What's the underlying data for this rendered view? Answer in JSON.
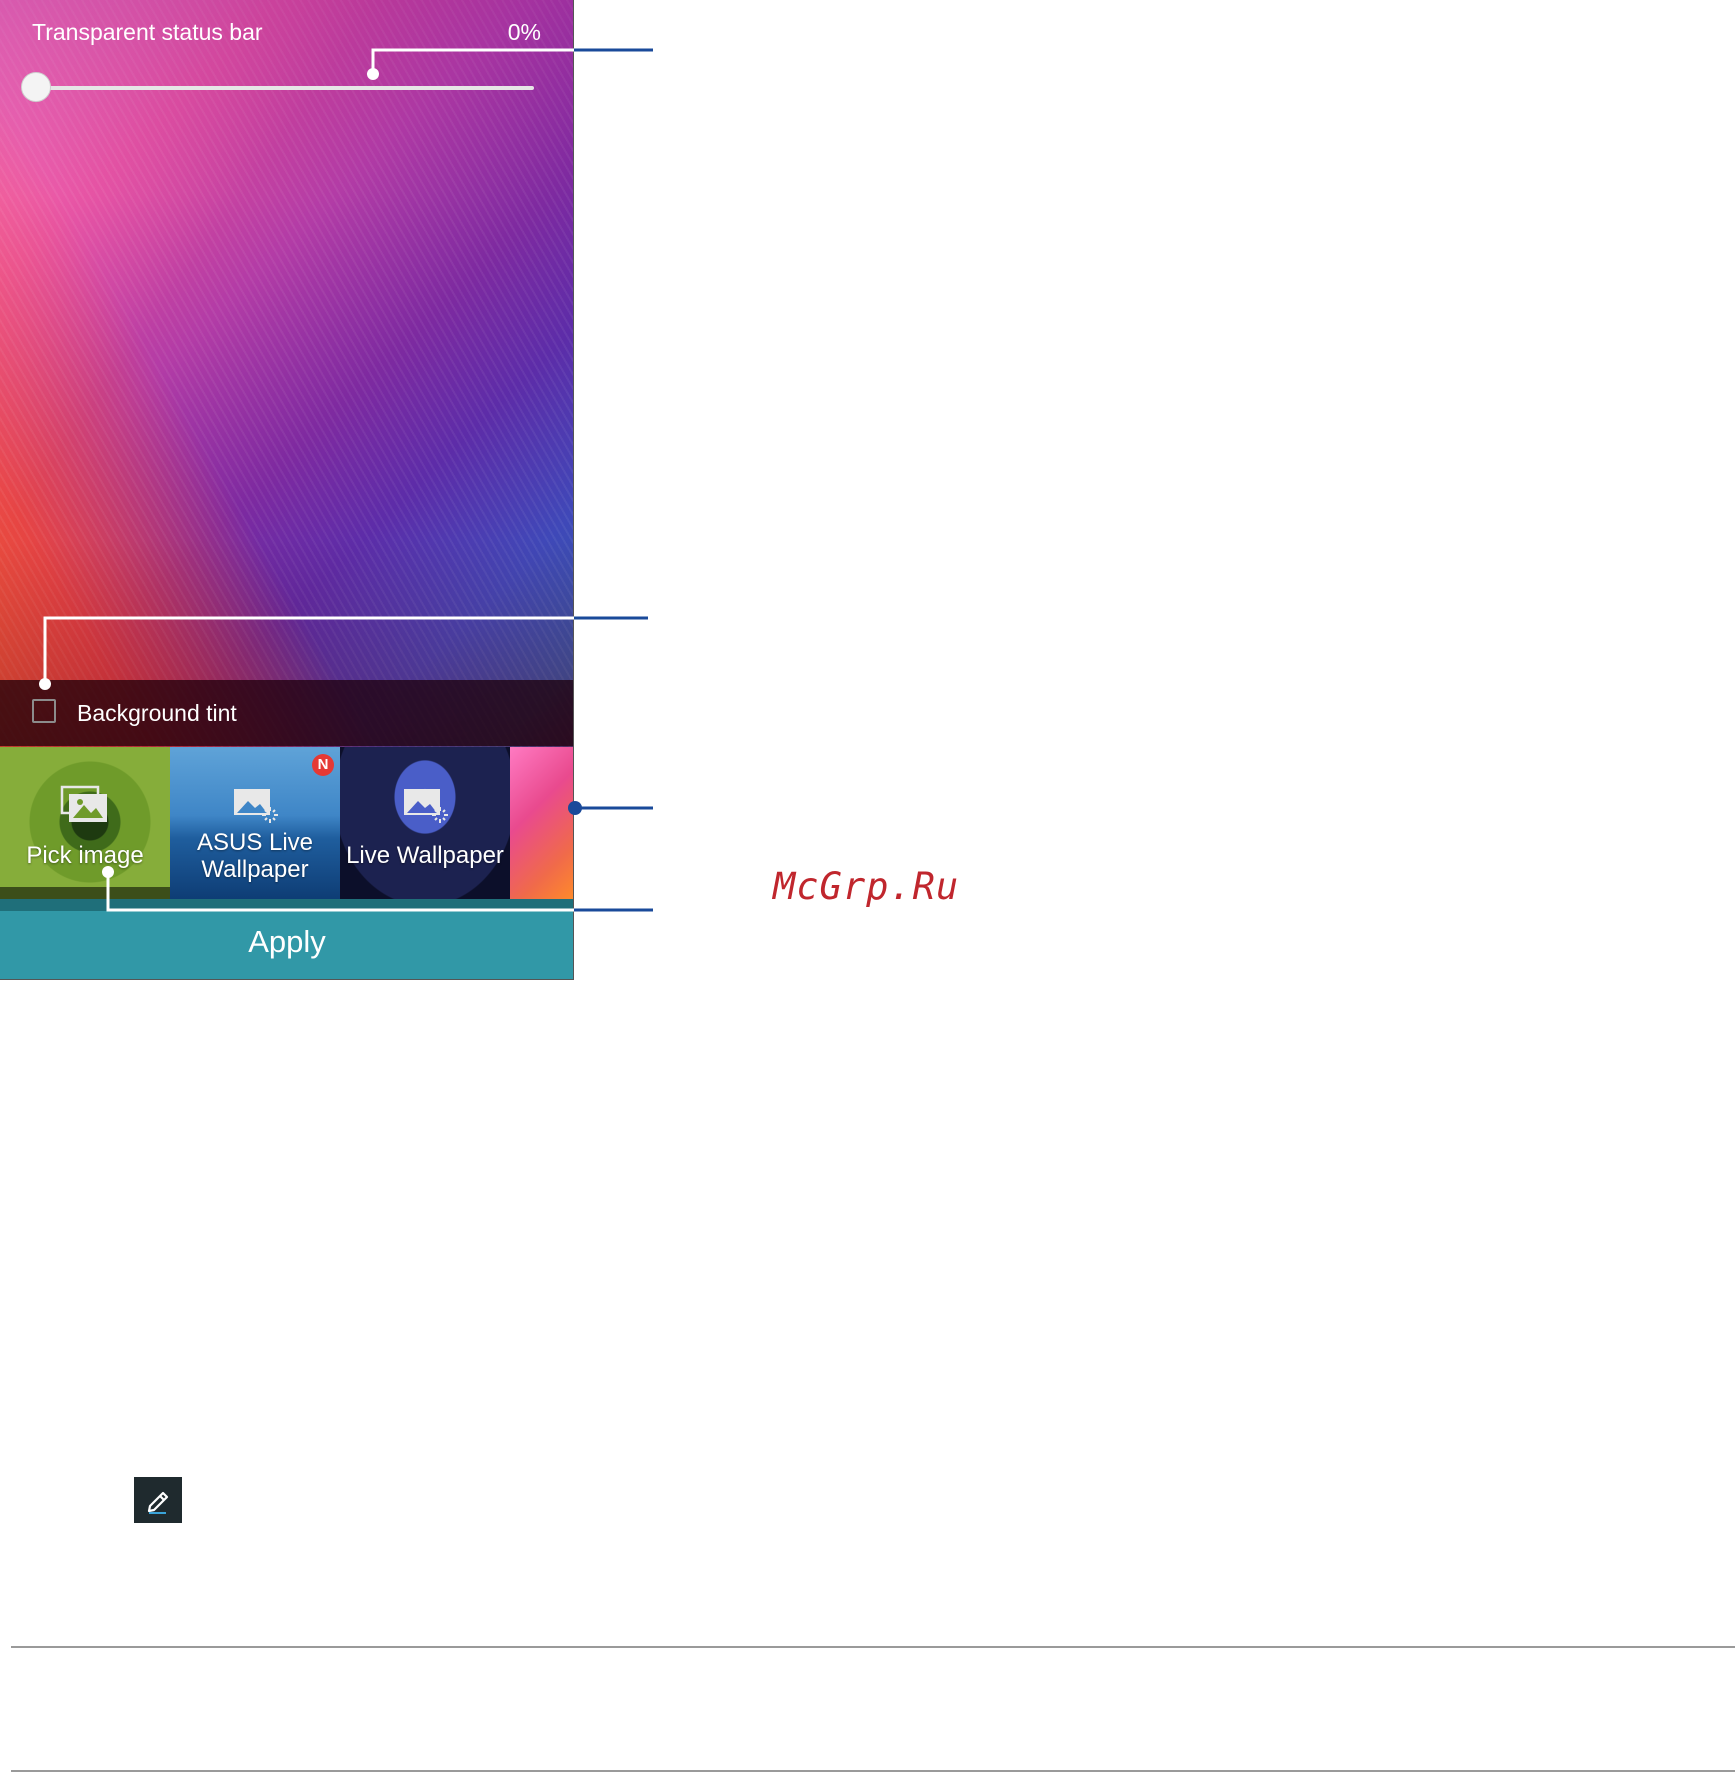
{
  "settings": {
    "status_bar_label": "Transparent status bar",
    "status_bar_value": "0%",
    "status_bar_fraction": 0.0,
    "background_tint_label": "Background tint",
    "background_tint_checked": false
  },
  "wallpapers": [
    {
      "label": "Pick image",
      "icon": "gallery-icon"
    },
    {
      "label": "ASUS Live Wallpaper",
      "icon": "live-wallpaper-icon",
      "badge": "N"
    },
    {
      "label": "Live Wallpaper",
      "icon": "live-wallpaper-icon"
    }
  ],
  "apply_label": "Apply",
  "watermark": "McGrp.Ru",
  "colors": {
    "apply_bar": "#3198a7",
    "callout": "#1a4a9a",
    "badge": "#e53935",
    "watermark": "#c0262d"
  }
}
